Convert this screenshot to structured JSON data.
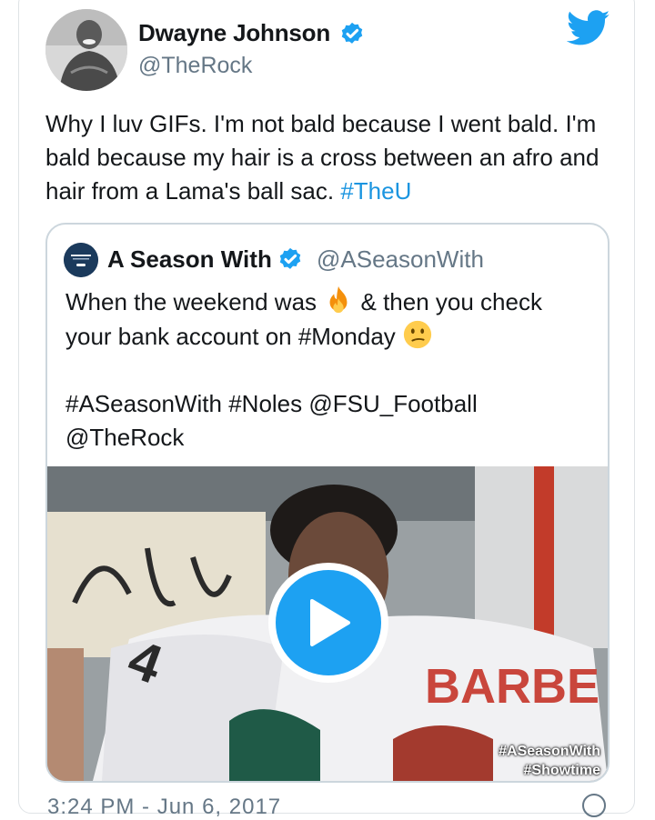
{
  "tweet": {
    "author_name": "Dwayne Johnson",
    "handle": "@TheRock",
    "text_parts": {
      "plain": "Why I luv GIFs. I'm not bald because I went bald. I'm bald because my hair is a cross between an afro and hair from a Lama's ball sac. ",
      "hashtag": "#TheU"
    }
  },
  "quoted_tweet": {
    "author_name": "A Season With",
    "handle": "@ASeasonWith",
    "line1_before_emoji": "When the weekend was ",
    "emoji1": "fire-emoji",
    "line1_after_emoji": " & then you check your bank account on #Monday ",
    "emoji2": "confused-face-emoji",
    "hashtags_line": "#ASeasonWith #Noles @FSU_Football",
    "mention_line": "@TheRock",
    "media_tags": [
      "#ASeasonWith",
      "#Showtime"
    ]
  },
  "footer": {
    "timestamp_partial": "3:24 PM - Jun 6, 2017"
  },
  "colors": {
    "link": "#1b95e0",
    "twitter_blue": "#1da1f2",
    "secondary_text": "#657786",
    "border": "#ccd6dd"
  },
  "icons": [
    "avatar",
    "verified-badge-icon",
    "twitter-bird-icon",
    "play-icon",
    "fire-emoji",
    "confused-face-emoji",
    "info-icon"
  ]
}
